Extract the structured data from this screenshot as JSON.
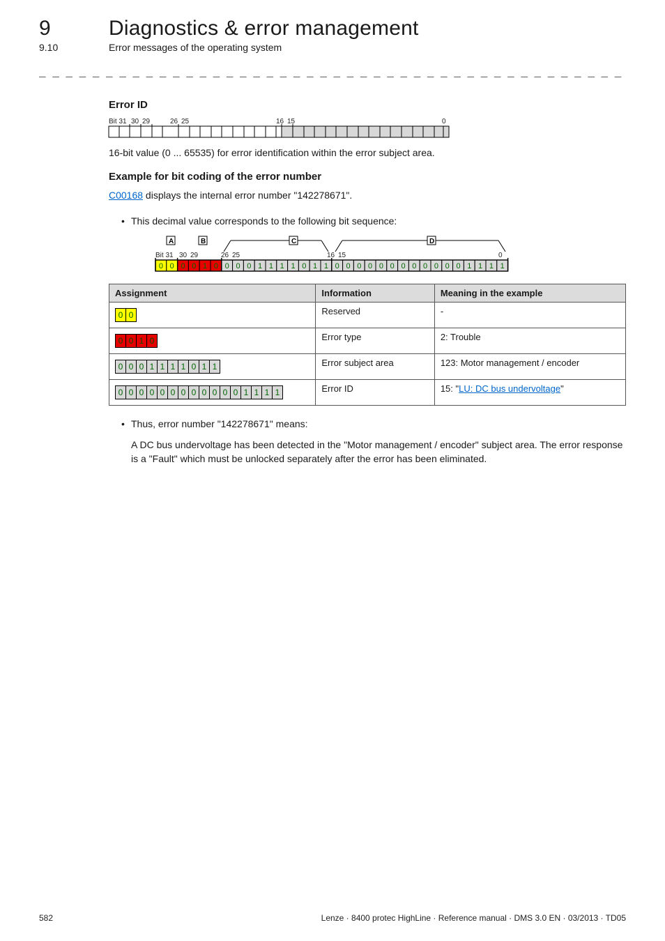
{
  "header": {
    "chapter_number": "9",
    "chapter_title": "Diagnostics & error management",
    "section_number": "9.10",
    "section_title": "Error messages of the operating system"
  },
  "dashline": "_ _ _ _ _ _ _ _ _ _ _ _ _ _ _ _ _ _ _ _ _ _ _ _ _ _ _ _ _ _ _ _ _ _ _ _ _ _ _ _ _ _ _ _ _ _ _ _ _ _ _ _ _ _ _ _ _ _ _ _ _ _ _ _",
  "errorid": {
    "heading": "Error ID",
    "bit_labels": [
      "Bit 31",
      "30",
      "29",
      "26",
      "25",
      "16",
      "15",
      "0"
    ],
    "caption": "16-bit value (0 ... 65535) for error identification within the error subject area."
  },
  "example": {
    "heading": "Example for bit coding of the error number",
    "line1_link": "C00168",
    "line1_rest": " displays the internal error number \"142278671\".",
    "bullet1": "This decimal value corresponds to the following bit sequence:",
    "legend": {
      "a": "A",
      "b": "B",
      "c": "C",
      "d": "D"
    },
    "bits_full": [
      "0",
      "0",
      "0",
      "0",
      "1",
      "0",
      "0",
      "0",
      "0",
      "1",
      "1",
      "1",
      "1",
      "0",
      "1",
      "1",
      "0",
      "0",
      "0",
      "0",
      "0",
      "0",
      "0",
      "0",
      "0",
      "0",
      "0",
      "0",
      "1",
      "1",
      "1",
      "1"
    ],
    "bit_labels2": [
      "Bit 31",
      "30",
      "29",
      "26",
      "25",
      "16",
      "15",
      "0"
    ]
  },
  "table": {
    "headers": [
      "Assignment",
      "Information",
      "Meaning in the example"
    ],
    "rows": [
      {
        "bits": [
          "0",
          "0"
        ],
        "bg": "bg-yellow",
        "info": "Reserved",
        "meaning": "-"
      },
      {
        "bits": [
          "0",
          "0",
          "1",
          "0"
        ],
        "bg": "bg-red",
        "info": "Error type",
        "meaning": "2: Trouble"
      },
      {
        "bits": [
          "0",
          "0",
          "0",
          "1",
          "1",
          "1",
          "1",
          "0",
          "1",
          "1"
        ],
        "bg": "bg-grey",
        "info": "Error subject area",
        "meaning": "123: Motor management / encoder"
      },
      {
        "bits": [
          "0",
          "0",
          "0",
          "0",
          "0",
          "0",
          "0",
          "0",
          "0",
          "0",
          "0",
          "0",
          "1",
          "1",
          "1",
          "1"
        ],
        "bg": "bg-grey",
        "info": "Error ID",
        "meaning_prefix": "15: \"",
        "meaning_link": "LU: DC bus undervoltage",
        "meaning_suffix": "\""
      }
    ]
  },
  "conclusion": {
    "bullet": "Thus, error number \"142278671\" means:",
    "text": "A DC bus undervoltage has been detected in the \"Motor management / encoder\" subject area. The error response is a \"Fault\" which must be unlocked separately after the error has been eliminated."
  },
  "footer": {
    "page": "582",
    "imprint": "Lenze · 8400 protec HighLine · Reference manual · DMS 3.0 EN · 03/2013 · TD05"
  }
}
